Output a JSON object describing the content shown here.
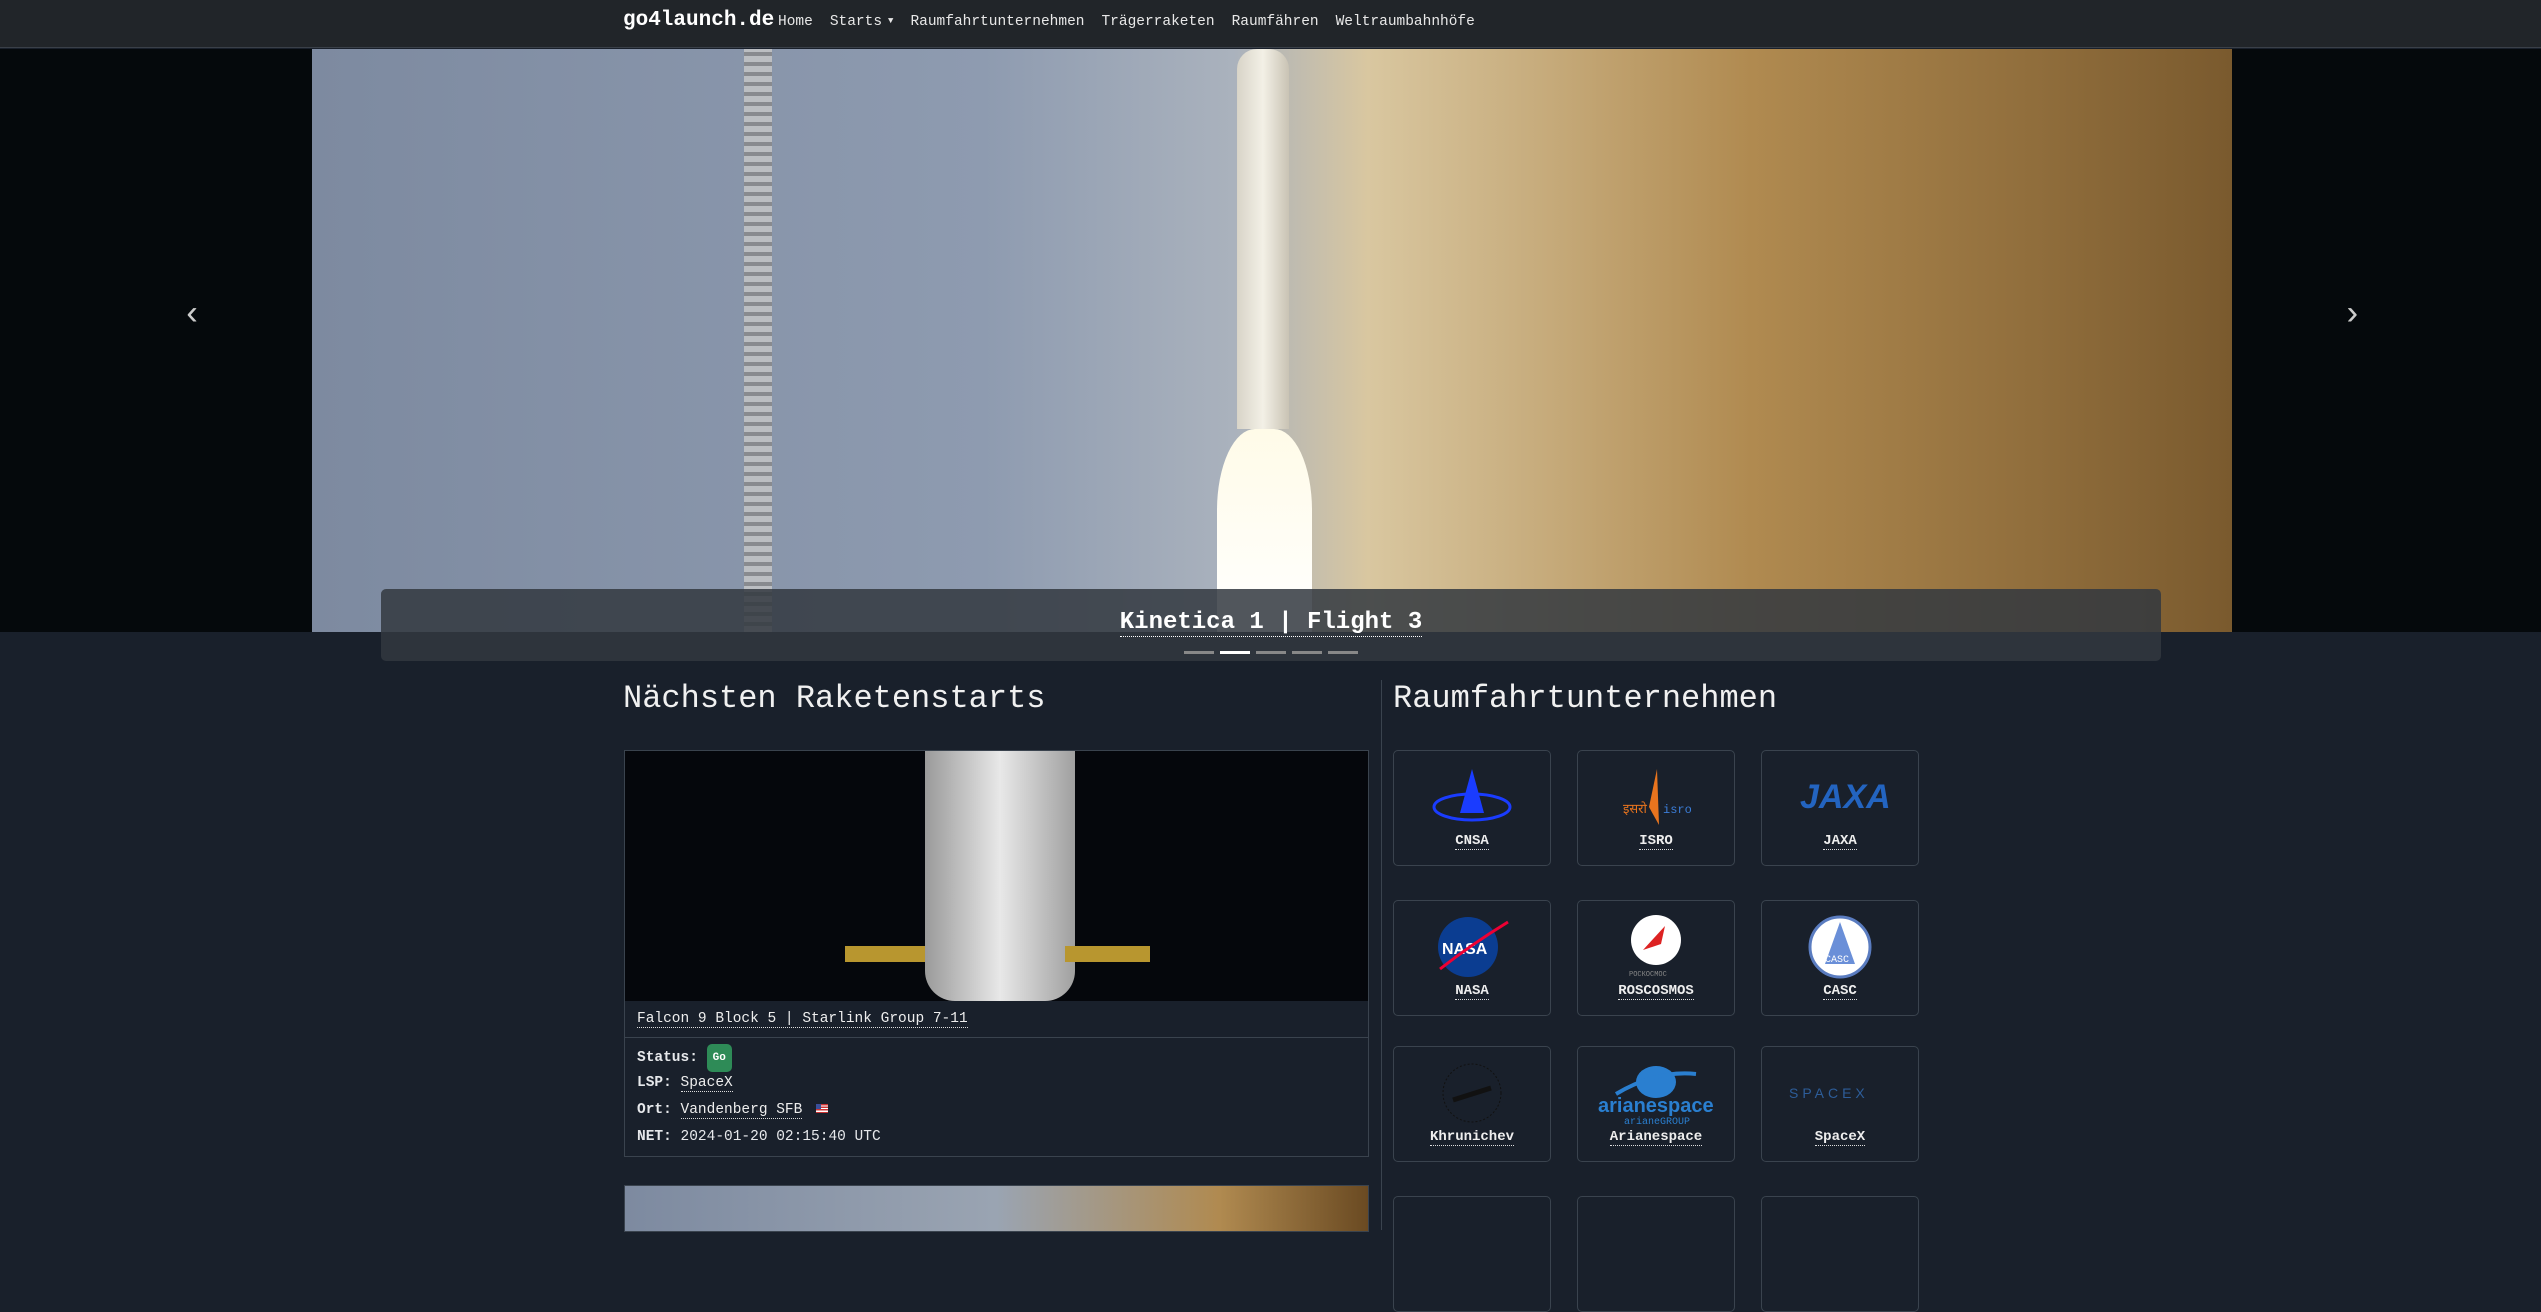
{
  "nav": {
    "brand": "go4launch.de",
    "items": [
      "Home",
      "Starts",
      "Raumfahrtunternehmen",
      "Trägerraketen",
      "Raumfähren",
      "Weltraumbahnhöfe"
    ]
  },
  "hero": {
    "caption": "Kinetica 1 | Flight 3",
    "slides": 5,
    "active_slide": 2
  },
  "launches": {
    "title": "Nächsten Raketenstarts",
    "items": [
      {
        "title": "Falcon 9 Block 5 | Starlink Group 7-11",
        "status_label": "Status:",
        "status": "Go",
        "status_color": "#2e8b57",
        "lsp_label": "LSP:",
        "lsp": "SpaceX",
        "location_label": "Ort:",
        "location": "Vandenberg SFB",
        "flag": "us-flag-icon",
        "net_label": "NET:",
        "net": "2024-01-20 02:15:40 UTC"
      }
    ]
  },
  "agencies": {
    "title": "Raumfahrtunternehmen",
    "items": [
      "CNSA",
      "ISRO",
      "JAXA",
      "NASA",
      "ROSCOSMOS",
      "CASC",
      "Khrunichev",
      "Arianespace",
      "SpaceX"
    ]
  }
}
